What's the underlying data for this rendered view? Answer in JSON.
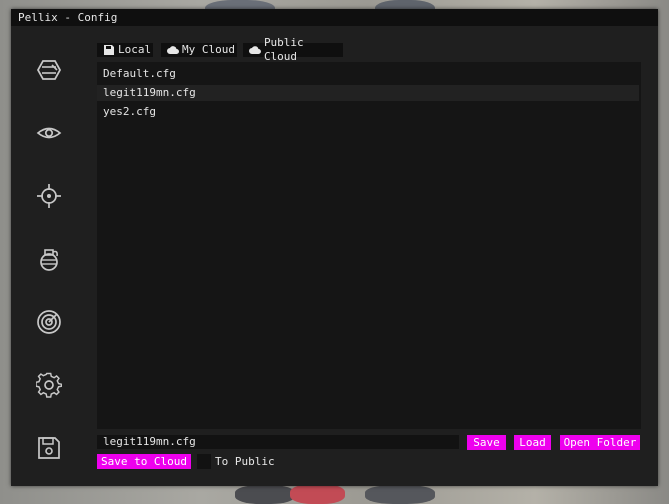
{
  "window": {
    "title": "Pellix - Config"
  },
  "sidebar": {
    "items": [
      {
        "icon": "rage-icon"
      },
      {
        "icon": "eye-icon"
      },
      {
        "icon": "crosshair-icon"
      },
      {
        "icon": "grenade-icon"
      },
      {
        "icon": "radar-icon"
      },
      {
        "icon": "gear-icon"
      },
      {
        "icon": "save-disk-icon"
      }
    ]
  },
  "tabs": [
    {
      "label": "Local",
      "icon": "floppy-icon"
    },
    {
      "label": "My Cloud",
      "icon": "cloud-icon"
    },
    {
      "label": "Public Cloud",
      "icon": "cloud-icon"
    }
  ],
  "configs": {
    "items": [
      "Default.cfg",
      "legit119mn.cfg",
      "yes2.cfg"
    ],
    "selected": "legit119mn.cfg"
  },
  "footer": {
    "filename_value": "legit119mn.cfg",
    "save_label": "Save",
    "load_label": "Load",
    "open_folder_label": "Open Folder",
    "save_to_cloud_label": "Save to Cloud",
    "to_public_label": "To Public",
    "to_public_checked": false
  },
  "colors": {
    "accent": "#ee00ee",
    "window_bg": "#1f1f1f",
    "panel_bg": "#151515",
    "titlebar_bg": "#0f0f0f",
    "text": "#e6e6e6"
  }
}
